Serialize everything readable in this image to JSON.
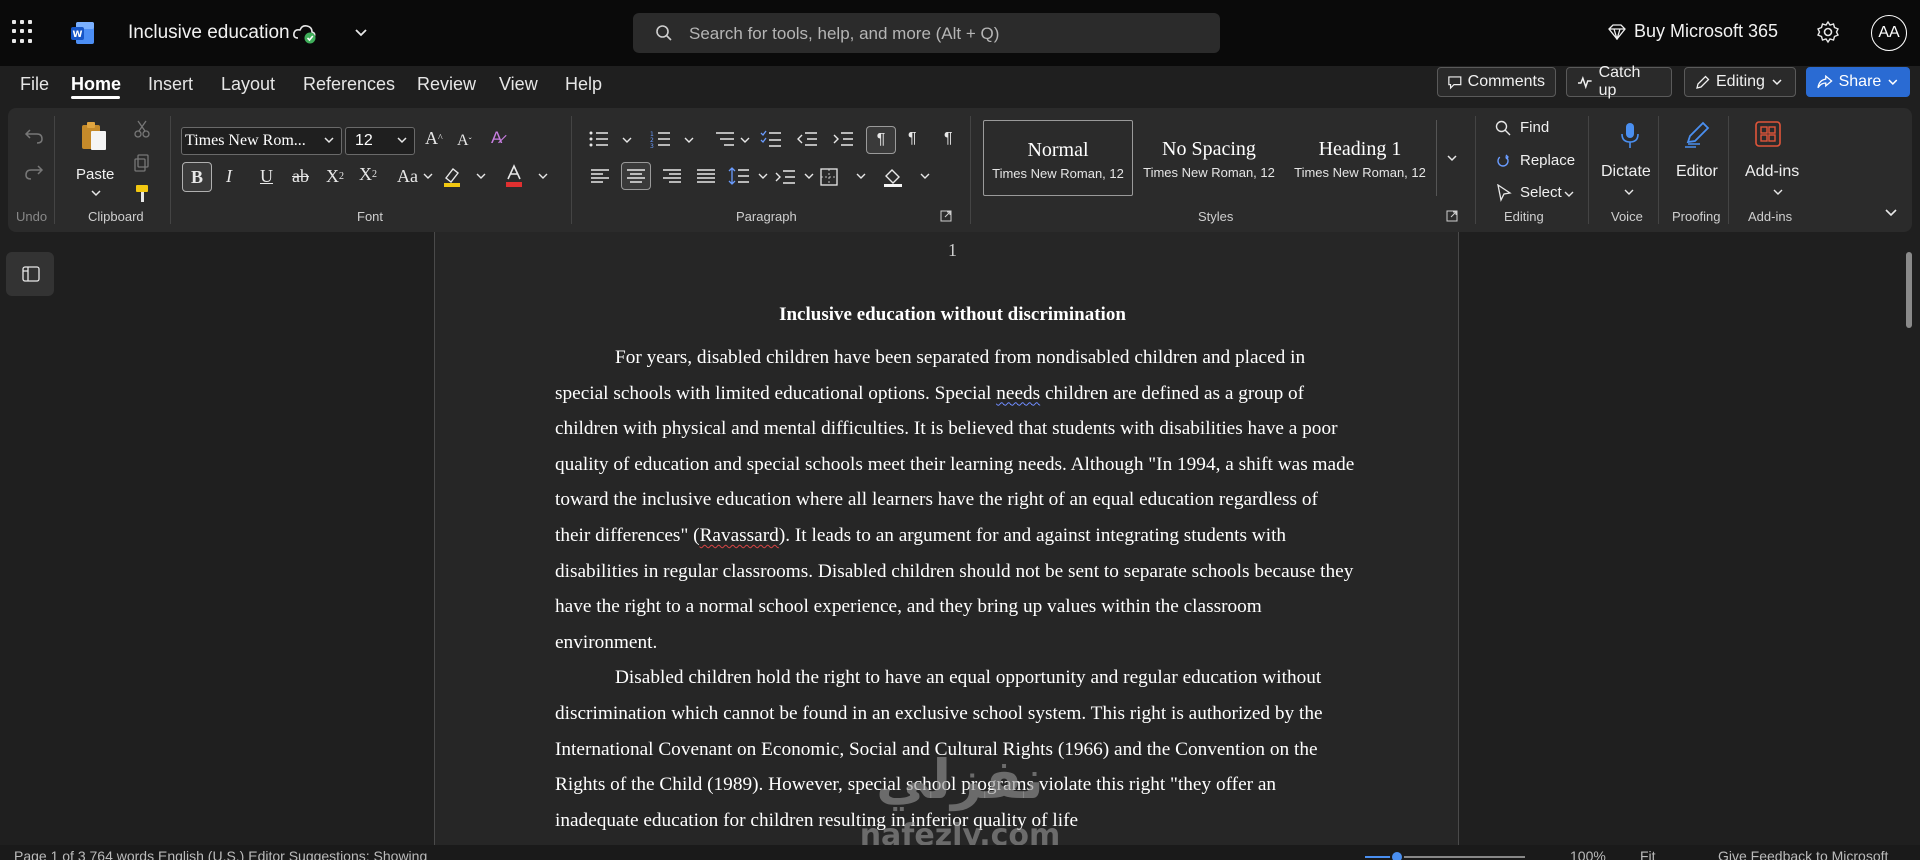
{
  "app": {
    "doc_title": "Inclusive education",
    "search_placeholder": "Search for tools, help, and more (Alt + Q)",
    "buy_label": "Buy Microsoft 365",
    "avatar_initials": "AA"
  },
  "menu": {
    "items": [
      "File",
      "Home",
      "Insert",
      "Layout",
      "References",
      "Review",
      "View",
      "Help"
    ],
    "active": "Home",
    "comments": "Comments",
    "catch_up": "Catch up",
    "editing": "Editing",
    "share": "Share"
  },
  "ribbon": {
    "undo_label": "Undo",
    "clipboard_label": "Clipboard",
    "paste_label": "Paste",
    "font_label": "Font",
    "font_name": "Times New Rom...",
    "font_size": "12",
    "paragraph_label": "Paragraph",
    "styles_label": "Styles",
    "styles": [
      {
        "name": "Normal",
        "sub": "Times New Roman, 12"
      },
      {
        "name": "No Spacing",
        "sub": "Times New Roman, 12"
      },
      {
        "name": "Heading 1",
        "sub": "Times New Roman, 12"
      }
    ],
    "find": "Find",
    "replace": "Replace",
    "select": "Select",
    "editing_label": "Editing",
    "dictate": "Dictate",
    "voice_label": "Voice",
    "editor": "Editor",
    "proofing_label": "Proofing",
    "addins": "Add-ins",
    "addins_label": "Add-ins",
    "colors": {
      "accent_blue": "#2a6bd3",
      "font_color_red": "#e03030",
      "highlight_yellow": "#f2c811"
    }
  },
  "document": {
    "page_number": "1",
    "heading": "Inclusive education without discrimination",
    "para1": {
      "a": "For years, disabled children have been separated from nondisabled children and placed in special schools with limited educational options. Special ",
      "w1": "needs",
      "b": " children are defined as a group of children with physical and mental difficulties. It is believed that students with disabilities have a poor quality of education and special schools meet their learning needs. Although \"In 1994, a shift was made toward the inclusive education where all learners have the right of an equal education regardless of their differences\" (",
      "w2": "Ravassard",
      "c": "). It leads to an argument for and against integrating students with disabilities in regular classrooms. Disabled children should not be sent to separate schools because they have the right to a normal school experience, and they bring up values within the classroom environment."
    },
    "para2": "Disabled children hold the right to have an equal opportunity and regular education without discrimination which cannot be found in an exclusive school system. This right is authorized by the International Covenant on Economic, Social and Cultural Rights (1966) and the Convention on the Rights of the Child (1989). However, special school programs violate this right \"they offer an inadequate education for children resulting in inferior quality of life"
  },
  "status": {
    "left": "Page 1 of 3    764 words    English (U.S.)    Editor Suggestions: Showing",
    "zoom": "100%",
    "fit": "Fit",
    "feedback": "Give Feedback to Microsoft",
    "zoom_level": 100
  },
  "watermark": {
    "arabic": "نفزلي",
    "latin": "nafezly.com"
  }
}
